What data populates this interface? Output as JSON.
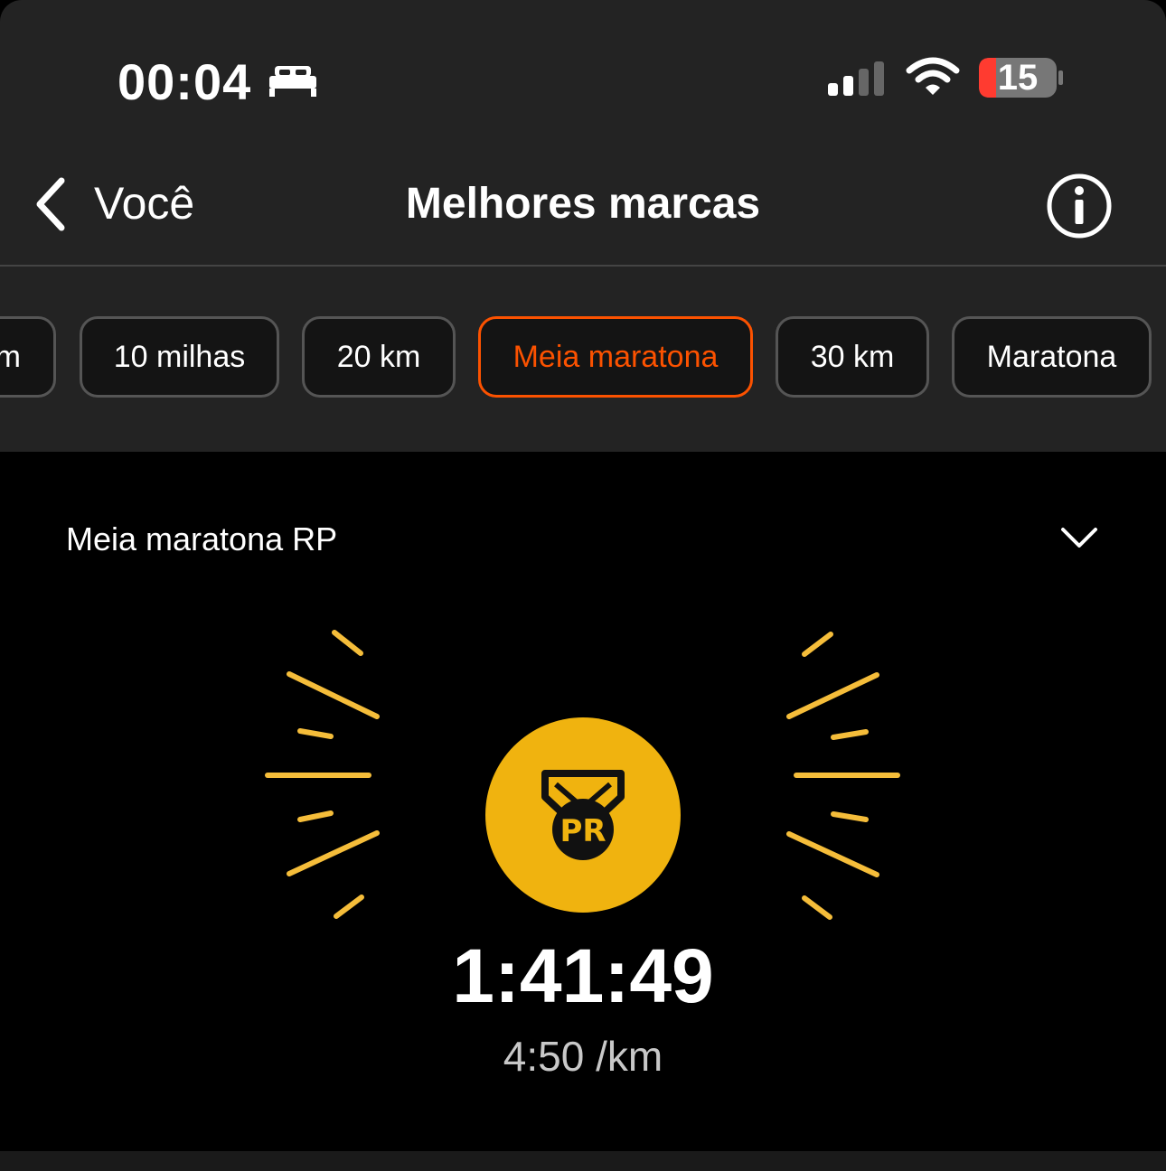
{
  "status_bar": {
    "time": "00:04",
    "battery_level": "15",
    "icons": [
      "bed-icon",
      "cellular-signal-icon",
      "wifi-icon",
      "battery-icon"
    ],
    "battery_color": "#ff3b30"
  },
  "nav": {
    "back_label": "Você",
    "title": "Melhores marcas",
    "info_icon": "info-icon"
  },
  "chips": [
    {
      "label": "m",
      "active": false
    },
    {
      "label": "10 milhas",
      "active": false
    },
    {
      "label": "20 km",
      "active": false
    },
    {
      "label": "Meia maratona",
      "active": true
    },
    {
      "label": "30 km",
      "active": false
    },
    {
      "label": "Maratona",
      "active": false
    }
  ],
  "record": {
    "section_label": "Meia maratona RP",
    "medal_text": "PR",
    "time": "1:41:49",
    "pace": "4:50 /km"
  },
  "colors": {
    "accent": "#fc5200",
    "medal": "#f0b30f",
    "rays": "#f5bd3a",
    "background": "#000000",
    "header": "#232323"
  }
}
